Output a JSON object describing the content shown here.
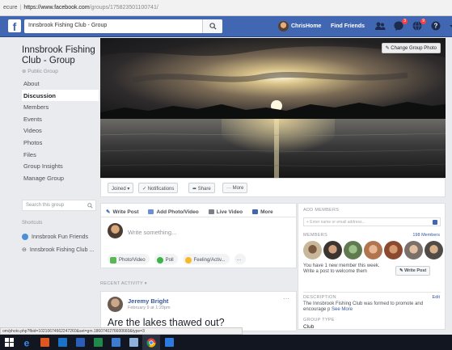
{
  "browser": {
    "security_text": "ecure",
    "url_host": "https://www.facebook.com",
    "url_path": "/groups/175823501100741/",
    "status_url": "om/photo.php?fbid=10210674662247260&set=gm.1860740276600660&type=3"
  },
  "topbar": {
    "logo": "f",
    "search_value": "Innsbrook Fishing Club - Group",
    "user_name": "Chris",
    "home_label": "Home",
    "find_friends_label": "Find Friends",
    "brand_color": "#4267b2"
  },
  "sidebar": {
    "group_name": "Innsbrook Fishing Club - Group",
    "privacy": "Public Group",
    "items": [
      {
        "label": "About",
        "active": false
      },
      {
        "label": "Discussion",
        "active": true
      },
      {
        "label": "Members",
        "active": false
      },
      {
        "label": "Events",
        "active": false
      },
      {
        "label": "Videos",
        "active": false
      },
      {
        "label": "Photos",
        "active": false
      },
      {
        "label": "Files",
        "active": false
      },
      {
        "label": "Group Insights",
        "active": false
      },
      {
        "label": "Manage Group",
        "active": false
      }
    ],
    "search_placeholder": "Search this group",
    "shortcuts_heading": "Shortcuts",
    "shortcuts": [
      {
        "label": "Innsbrook Fun Friends"
      },
      {
        "label": "Innsbrook Fishing Club ..."
      }
    ]
  },
  "cover": {
    "change_photo_label": "Change Group Photo"
  },
  "actions": {
    "joined": "Joined ▾",
    "notifications": "✓ Notifications",
    "share": "Share",
    "more": "··· More"
  },
  "composer": {
    "tabs": [
      "Write Post",
      "Add Photo/Video",
      "Live Video",
      "More"
    ],
    "placeholder": "Write something...",
    "photo_video": "Photo/Video",
    "poll": "Poll",
    "feeling": "Feeling/Activ...",
    "more_dots": "···"
  },
  "feed": {
    "recent_activity": "RECENT ACTIVITY ▾",
    "post": {
      "author": "Jeremy Bright",
      "date": "February 9 at 1:20pm",
      "more": "···",
      "text": "Are the lakes thawed out?"
    }
  },
  "right": {
    "add_members_heading": "ADD MEMBERS",
    "add_members_placeholder": "+ Enter name or email address...",
    "members_heading": "MEMBERS",
    "all_members": "198 Members",
    "new_member_text": "You have 1 new member this week. Write a post to welcome them",
    "write_post": "Write Post",
    "description_heading": "DESCRIPTION",
    "edit": "Edit",
    "description": "The Innsbrook Fishing Club was formed to promote and encourage p",
    "see_more": "See More",
    "group_type_heading": "GROUP TYPE",
    "group_type": "Club"
  },
  "taskbar": {
    "items": [
      "start",
      "edge",
      "office",
      "outlook",
      "word",
      "excel",
      "powerpoint",
      "paint",
      "chrome",
      "app"
    ]
  }
}
